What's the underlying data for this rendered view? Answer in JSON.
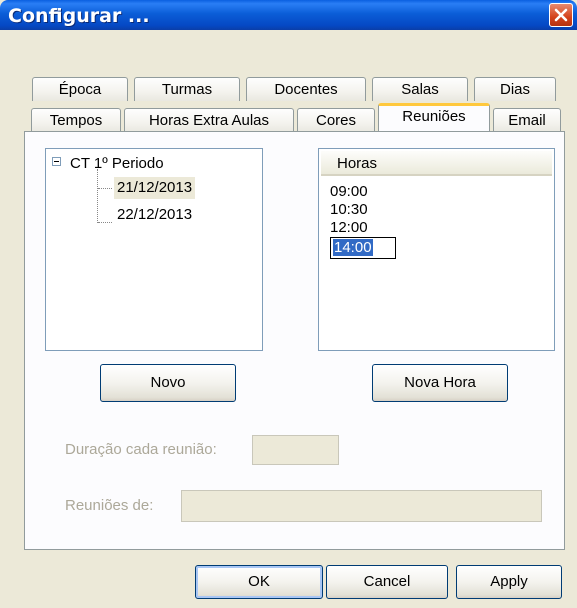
{
  "window": {
    "title": "Configurar ..."
  },
  "tabs": {
    "row_back": [
      {
        "label": "Época"
      },
      {
        "label": "Turmas"
      },
      {
        "label": "Docentes"
      },
      {
        "label": "Salas"
      },
      {
        "label": "Dias"
      }
    ],
    "row_front": [
      {
        "label": "Tempos"
      },
      {
        "label": "Horas Extra Aulas"
      },
      {
        "label": "Cores"
      },
      {
        "label": "Reuniões",
        "active": true
      },
      {
        "label": "Email"
      }
    ]
  },
  "tree": {
    "root": "CT 1º Periodo",
    "children": [
      "21/12/2013",
      "22/12/2013"
    ],
    "selected_index": 0
  },
  "hours_list": {
    "header": "Horas",
    "items": [
      "09:00",
      "10:30",
      "12:00",
      "14:00"
    ],
    "editing_index": 3
  },
  "buttons": {
    "novo": "Novo",
    "nova_hora": "Nova Hora",
    "ok": "OK",
    "cancel": "Cancel",
    "apply": "Apply"
  },
  "fields": {
    "duracao_label": "Duração cada reunião:",
    "duracao_value": "",
    "reunioes_de_label": "Reuniões de:",
    "reunioes_de_value": ""
  },
  "icons": {
    "close": "close-icon",
    "tree_expander": "collapse-icon"
  },
  "colors": {
    "title_bar": "#0b5ed8",
    "close_button": "#d4431b",
    "active_tab_accent": "#ffc83c",
    "selection_highlight": "#316ac5",
    "dialog_background": "#ece9d8"
  }
}
